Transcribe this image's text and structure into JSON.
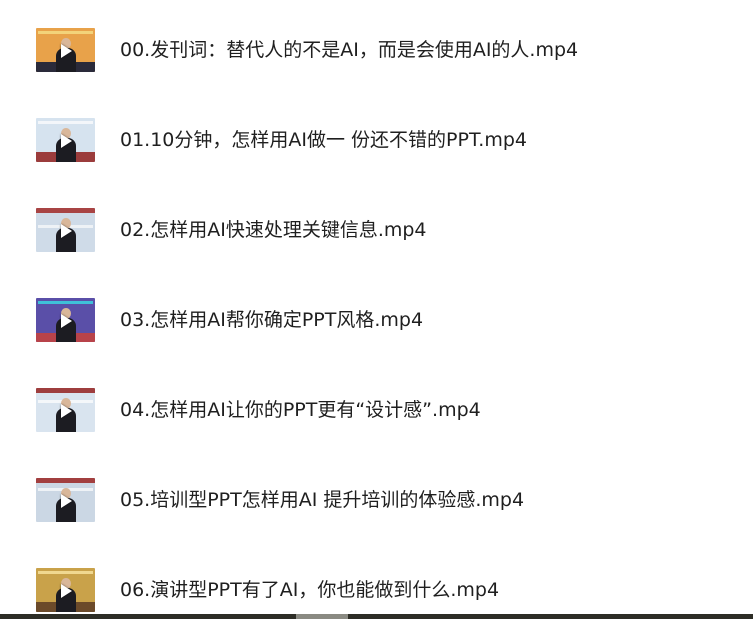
{
  "files": [
    {
      "name": "00.发刊词：替代人的不是AI，而是会使用AI的人.mp4",
      "thumb": {
        "bg": "#e8a24a",
        "band": "#2a2a3a",
        "accent": "#f3d37a"
      }
    },
    {
      "name": "01.10分钟，怎样用AI做一 份还不错的PPT.mp4",
      "thumb": {
        "bg": "#d6e3ef",
        "band": "#9b3c3c",
        "accent": "#f3f6fa"
      }
    },
    {
      "name": "02.怎样用AI快速处理关键信息.mp4",
      "thumb": {
        "bg": "#cfdbe8",
        "band": "#a84444",
        "accent": "#eef2f6"
      }
    },
    {
      "name": "03.怎样用AI帮你确定PPT风格.mp4",
      "thumb": {
        "bg": "#5a4fa8",
        "band": "#b8434a",
        "accent": "#3fc0d8"
      }
    },
    {
      "name": "04.怎样用AI让你的PPT更有“设计感”.mp4",
      "thumb": {
        "bg": "#d9e4ef",
        "band": "#9e3e3e",
        "accent": "#f4f7fa"
      }
    },
    {
      "name": "05.培训型PPT怎样用AI 提升培训的体验感.mp4",
      "thumb": {
        "bg": "#cbd7e4",
        "band": "#a23f3f",
        "accent": "#eef2f6"
      }
    },
    {
      "name": "06.演讲型PPT有了AI，你也能做到什么.mp4",
      "thumb": {
        "bg": "#c9a24a",
        "band": "#6b4a2a",
        "accent": "#f0d890"
      }
    }
  ],
  "colors": {
    "text": "#1f1f1f",
    "background": "#ffffff",
    "bottom_bar": "#2d2d26"
  },
  "icons": {
    "play": "play-icon"
  }
}
